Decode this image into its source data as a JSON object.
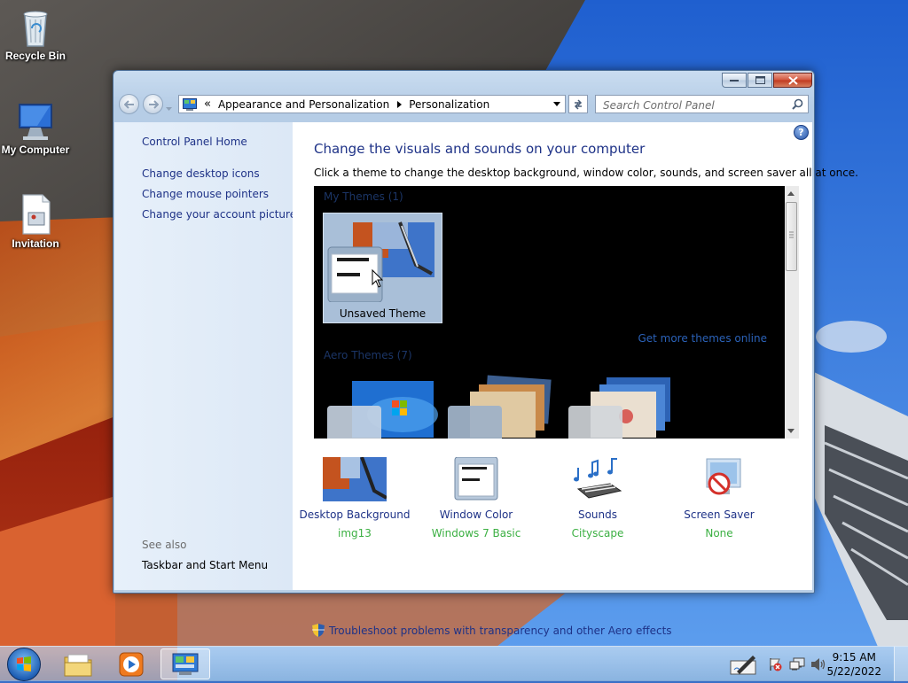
{
  "desktop": {
    "icons": [
      {
        "label": "Recycle Bin"
      },
      {
        "label": "My Computer"
      },
      {
        "label": "Invitation"
      }
    ]
  },
  "window": {
    "address_sep": "«",
    "breadcrumb": [
      "Appearance and Personalization",
      "Personalization"
    ],
    "search_placeholder": "Search Control Panel",
    "help_label": "?",
    "left_pane": {
      "home_link": "Control Panel Home",
      "links": [
        "Change desktop icons",
        "Change mouse pointers",
        "Change your account picture"
      ],
      "see_also_header": "See also",
      "see_also_links": [
        "Taskbar and Start Menu"
      ]
    },
    "content": {
      "title": "Change the visuals and sounds on your computer",
      "subtitle": "Click a theme to change the desktop background, window color, sounds, and screen saver all at once.",
      "my_themes_label": "My Themes (1)",
      "unsaved_theme_label": "Unsaved Theme",
      "get_more_link": "Get more themes online",
      "aero_themes_label": "Aero Themes (7)"
    },
    "settings": [
      {
        "label": "Desktop Background",
        "value": "img13",
        "icon": "desktop-background-icon"
      },
      {
        "label": "Window Color",
        "value": "Windows 7 Basic",
        "icon": "window-color-icon"
      },
      {
        "label": "Sounds",
        "value": "Cityscape",
        "icon": "sounds-icon"
      },
      {
        "label": "Screen Saver",
        "value": "None",
        "icon": "screen-saver-icon"
      }
    ],
    "troubleshoot_link": "Troubleshoot problems with transparency and other Aero effects"
  },
  "taskbar": {
    "time": "9:15 AM",
    "date": "5/22/2022"
  },
  "colors": {
    "link": "#1e3287",
    "value_green": "#3cb043",
    "left_pane_bg": "#e7f0fa"
  }
}
